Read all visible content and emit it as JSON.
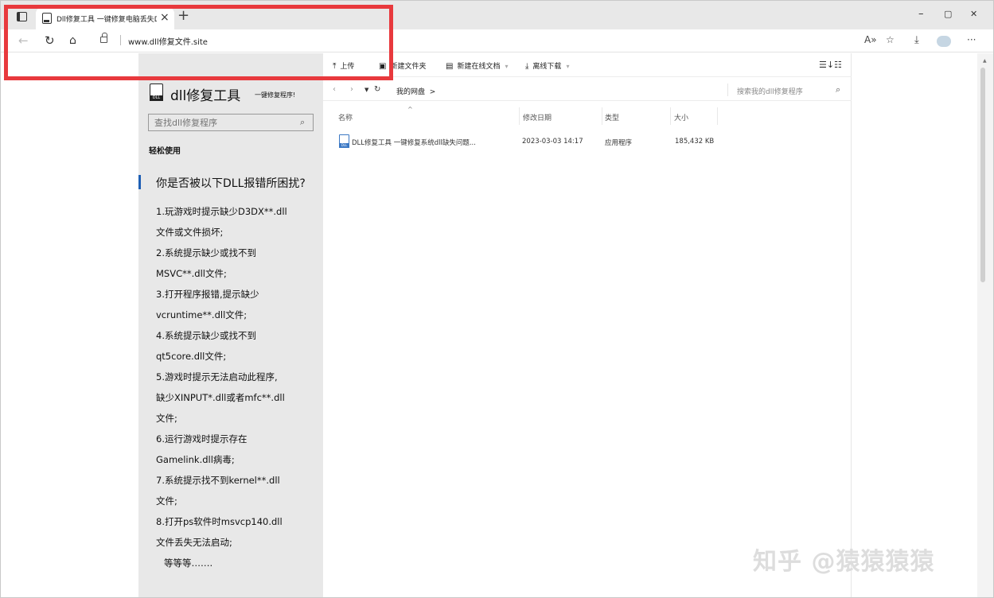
{
  "browser": {
    "tab_title": "Dll修复工具 一键修复电脑丢失D",
    "url": "www.dll修复文件.site",
    "new_tab_symbol": "+",
    "close_tab_symbol": "×",
    "minimize_symbol": "–",
    "maximize_symbol": "▢",
    "close_window_symbol": "✕"
  },
  "sidebar": {
    "brand_name": "dll修复工具",
    "brand_sub": "一键修复程序!",
    "search_placeholder": "查找dll修复程序",
    "section_title": "轻松使用",
    "question": "你是否被以下DLL报错所困扰?",
    "issues": [
      "1.玩游戏时提示缺少D3DX**.dll",
      "文件或文件损坏;",
      "2.系统提示缺少或找不到",
      "MSVC**.dll文件;",
      "3.打开程序报错,提示缺少",
      "vcruntime**.dll文件;",
      "4.系统提示缺少或找不到",
      "qt5core.dll文件;",
      "5.游戏时提示无法启动此程序,",
      "缺少XINPUT*.dll或者mfc**.dll",
      "文件;",
      "6.运行游戏时提示存在",
      "Gamelink.dll病毒;",
      "7.系统提示找不到kernel**.dll",
      "文件;",
      "8.打开ps软件时msvcp140.dll",
      "文件丢失无法启动;",
      "等等等……."
    ]
  },
  "toolbar": {
    "upload": "上传",
    "new_folder": "新建文件夹",
    "new_doc": "新建在线文档",
    "offline_download": "离线下载"
  },
  "pathbar": {
    "crumb": "我的网盘",
    "crumb_arrow": ">",
    "search_placeholder": "搜索我的dll修复程序"
  },
  "file_table": {
    "headers": [
      "名称",
      "修改日期",
      "类型",
      "大小"
    ],
    "rows": [
      {
        "name": "DLL修复工具 一键修复系统dll缺失问题...",
        "modified": "2023-03-03 14:17",
        "type": "应用程序",
        "size": "185,432 KB"
      }
    ]
  },
  "watermark": "知乎 @猿猿猿猿",
  "accent_colors": {
    "highlight_border": "#e8393d",
    "sidebar_bar": "#1e5fb4",
    "file_icon": "#3b78c4"
  }
}
